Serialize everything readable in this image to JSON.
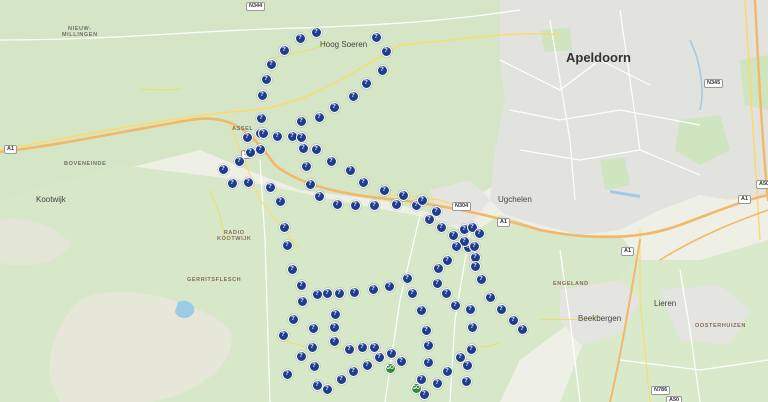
{
  "colors": {
    "forest": "#d4e6c6",
    "urban": "#e2e2df",
    "motorway": "#f3b768",
    "water": "#9ccbea",
    "marker": "#1f3d8f",
    "marker_green": "#2e8b35"
  },
  "places": [
    {
      "id": "apeldoorn",
      "text": "Apeldoorn",
      "kind": "city"
    },
    {
      "id": "hoog-soeren",
      "text": "Hoog Soeren",
      "kind": "town"
    },
    {
      "id": "ugchelen",
      "text": "Ugchelen",
      "kind": "town"
    },
    {
      "id": "kootwijk",
      "text": "Kootwijk",
      "kind": "town"
    },
    {
      "id": "lieren",
      "text": "Lieren",
      "kind": "town"
    },
    {
      "id": "beekbergen",
      "text": "Beekbergen",
      "kind": "town"
    },
    {
      "id": "nieuw-millingen",
      "text": "NIEUW-\nMILLINGEN",
      "kind": "area"
    },
    {
      "id": "assel",
      "text": "ASSEL",
      "kind": "area"
    },
    {
      "id": "boveneinde",
      "text": "BOVENEINDE",
      "kind": "area"
    },
    {
      "id": "radio-kootwijk",
      "text": "RADIO\nKOOTWIJK",
      "kind": "area"
    },
    {
      "id": "gerritsflesch",
      "text": "GERRITSFLESCH",
      "kind": "area"
    },
    {
      "id": "engeland",
      "text": "ENGELAND",
      "kind": "area"
    },
    {
      "id": "oosterhuizen",
      "text": "OOSTERHUIZEN",
      "kind": "area"
    }
  ],
  "road_labels": [
    {
      "id": "n344",
      "text": "N344"
    },
    {
      "id": "n345",
      "text": "N345"
    },
    {
      "id": "n304",
      "text": "N304"
    },
    {
      "id": "a1-west",
      "text": "A1"
    },
    {
      "id": "a1-assel",
      "text": "1"
    },
    {
      "id": "a1-ugchelen",
      "text": "A1"
    },
    {
      "id": "a1-south",
      "text": "A1"
    },
    {
      "id": "a1-east",
      "text": "A1"
    },
    {
      "id": "a50-east",
      "text": "A50"
    },
    {
      "id": "a50-south",
      "text": "A50"
    },
    {
      "id": "n786",
      "text": "N786"
    }
  ],
  "marker_glyph": "?",
  "marker_glyph_green": "GO",
  "marker_count": 122
}
